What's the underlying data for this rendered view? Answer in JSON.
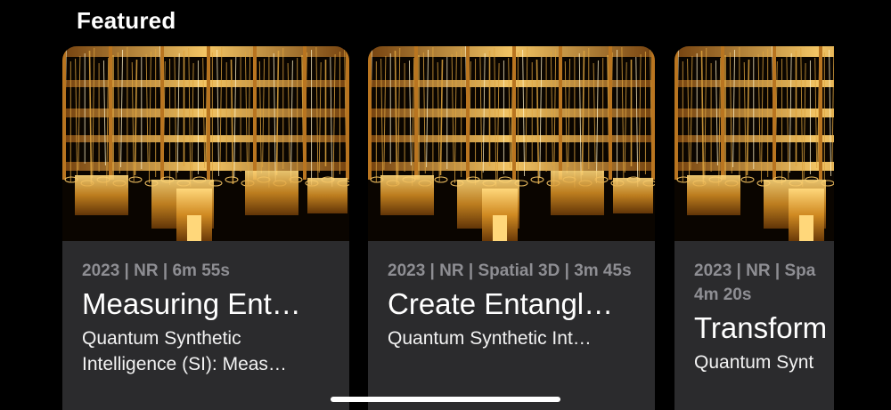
{
  "section": {
    "title": "Featured"
  },
  "cards": [
    {
      "meta": "2023 | NR | 6m 55s",
      "title": "Measuring Ent…",
      "subtitle": "Quantum Synthetic Intelligence (SI): Meas…",
      "image": "gold-quantum-computer-chandelier"
    },
    {
      "meta": "2023 | NR | Spatial 3D | 3m 45s",
      "title": "Create Entangl…",
      "subtitle": "Quantum Synthetic Int…",
      "image": "gold-quantum-computer-chandelier"
    },
    {
      "meta": "2023 | NR | Spa 4m 20s",
      "title": "Transform",
      "subtitle": "Quantum Synt",
      "image": "gold-quantum-computer-chandelier"
    }
  ],
  "colors": {
    "background": "#000000",
    "card": "#2b2b2d",
    "meta_text": "#8e8e93",
    "gold": "#d9a23a"
  }
}
